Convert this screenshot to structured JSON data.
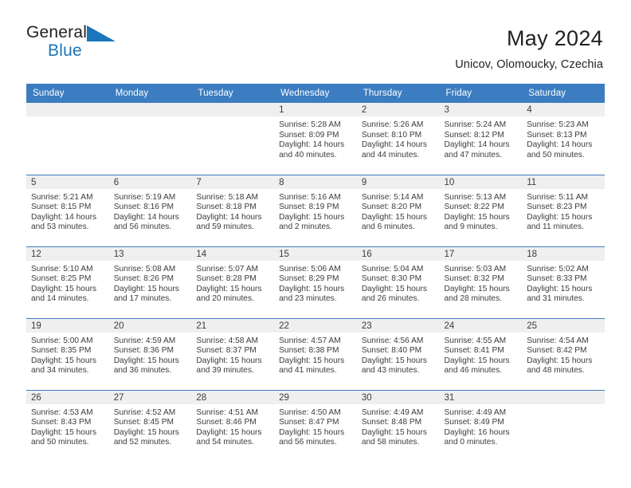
{
  "brand": {
    "name_top": "General",
    "name_bottom": "Blue",
    "accent_color": "#1b75bb"
  },
  "header": {
    "title": "May 2024",
    "subtitle": "Unicov, Olomoucky, Czechia",
    "header_bg_color": "#3b7dc0",
    "daynum_band_color": "#efefef"
  },
  "weekday_headers": [
    "Sunday",
    "Monday",
    "Tuesday",
    "Wednesday",
    "Thursday",
    "Friday",
    "Saturday"
  ],
  "labels": {
    "sunrise": "Sunrise:",
    "sunset": "Sunset:",
    "daylight": "Daylight:"
  },
  "weeks": [
    [
      {
        "day": "",
        "text": ""
      },
      {
        "day": "",
        "text": ""
      },
      {
        "day": "",
        "text": ""
      },
      {
        "day": "1",
        "text": "Sunrise: 5:28 AM\nSunset: 8:09 PM\nDaylight: 14 hours\nand 40 minutes."
      },
      {
        "day": "2",
        "text": "Sunrise: 5:26 AM\nSunset: 8:10 PM\nDaylight: 14 hours\nand 44 minutes."
      },
      {
        "day": "3",
        "text": "Sunrise: 5:24 AM\nSunset: 8:12 PM\nDaylight: 14 hours\nand 47 minutes."
      },
      {
        "day": "4",
        "text": "Sunrise: 5:23 AM\nSunset: 8:13 PM\nDaylight: 14 hours\nand 50 minutes."
      }
    ],
    [
      {
        "day": "5",
        "text": "Sunrise: 5:21 AM\nSunset: 8:15 PM\nDaylight: 14 hours\nand 53 minutes."
      },
      {
        "day": "6",
        "text": "Sunrise: 5:19 AM\nSunset: 8:16 PM\nDaylight: 14 hours\nand 56 minutes."
      },
      {
        "day": "7",
        "text": "Sunrise: 5:18 AM\nSunset: 8:18 PM\nDaylight: 14 hours\nand 59 minutes."
      },
      {
        "day": "8",
        "text": "Sunrise: 5:16 AM\nSunset: 8:19 PM\nDaylight: 15 hours\nand 2 minutes."
      },
      {
        "day": "9",
        "text": "Sunrise: 5:14 AM\nSunset: 8:20 PM\nDaylight: 15 hours\nand 6 minutes."
      },
      {
        "day": "10",
        "text": "Sunrise: 5:13 AM\nSunset: 8:22 PM\nDaylight: 15 hours\nand 9 minutes."
      },
      {
        "day": "11",
        "text": "Sunrise: 5:11 AM\nSunset: 8:23 PM\nDaylight: 15 hours\nand 11 minutes."
      }
    ],
    [
      {
        "day": "12",
        "text": "Sunrise: 5:10 AM\nSunset: 8:25 PM\nDaylight: 15 hours\nand 14 minutes."
      },
      {
        "day": "13",
        "text": "Sunrise: 5:08 AM\nSunset: 8:26 PM\nDaylight: 15 hours\nand 17 minutes."
      },
      {
        "day": "14",
        "text": "Sunrise: 5:07 AM\nSunset: 8:28 PM\nDaylight: 15 hours\nand 20 minutes."
      },
      {
        "day": "15",
        "text": "Sunrise: 5:06 AM\nSunset: 8:29 PM\nDaylight: 15 hours\nand 23 minutes."
      },
      {
        "day": "16",
        "text": "Sunrise: 5:04 AM\nSunset: 8:30 PM\nDaylight: 15 hours\nand 26 minutes."
      },
      {
        "day": "17",
        "text": "Sunrise: 5:03 AM\nSunset: 8:32 PM\nDaylight: 15 hours\nand 28 minutes."
      },
      {
        "day": "18",
        "text": "Sunrise: 5:02 AM\nSunset: 8:33 PM\nDaylight: 15 hours\nand 31 minutes."
      }
    ],
    [
      {
        "day": "19",
        "text": "Sunrise: 5:00 AM\nSunset: 8:35 PM\nDaylight: 15 hours\nand 34 minutes."
      },
      {
        "day": "20",
        "text": "Sunrise: 4:59 AM\nSunset: 8:36 PM\nDaylight: 15 hours\nand 36 minutes."
      },
      {
        "day": "21",
        "text": "Sunrise: 4:58 AM\nSunset: 8:37 PM\nDaylight: 15 hours\nand 39 minutes."
      },
      {
        "day": "22",
        "text": "Sunrise: 4:57 AM\nSunset: 8:38 PM\nDaylight: 15 hours\nand 41 minutes."
      },
      {
        "day": "23",
        "text": "Sunrise: 4:56 AM\nSunset: 8:40 PM\nDaylight: 15 hours\nand 43 minutes."
      },
      {
        "day": "24",
        "text": "Sunrise: 4:55 AM\nSunset: 8:41 PM\nDaylight: 15 hours\nand 46 minutes."
      },
      {
        "day": "25",
        "text": "Sunrise: 4:54 AM\nSunset: 8:42 PM\nDaylight: 15 hours\nand 48 minutes."
      }
    ],
    [
      {
        "day": "26",
        "text": "Sunrise: 4:53 AM\nSunset: 8:43 PM\nDaylight: 15 hours\nand 50 minutes."
      },
      {
        "day": "27",
        "text": "Sunrise: 4:52 AM\nSunset: 8:45 PM\nDaylight: 15 hours\nand 52 minutes."
      },
      {
        "day": "28",
        "text": "Sunrise: 4:51 AM\nSunset: 8:46 PM\nDaylight: 15 hours\nand 54 minutes."
      },
      {
        "day": "29",
        "text": "Sunrise: 4:50 AM\nSunset: 8:47 PM\nDaylight: 15 hours\nand 56 minutes."
      },
      {
        "day": "30",
        "text": "Sunrise: 4:49 AM\nSunset: 8:48 PM\nDaylight: 15 hours\nand 58 minutes."
      },
      {
        "day": "31",
        "text": "Sunrise: 4:49 AM\nSunset: 8:49 PM\nDaylight: 16 hours\nand 0 minutes."
      },
      {
        "day": "",
        "text": ""
      }
    ]
  ]
}
